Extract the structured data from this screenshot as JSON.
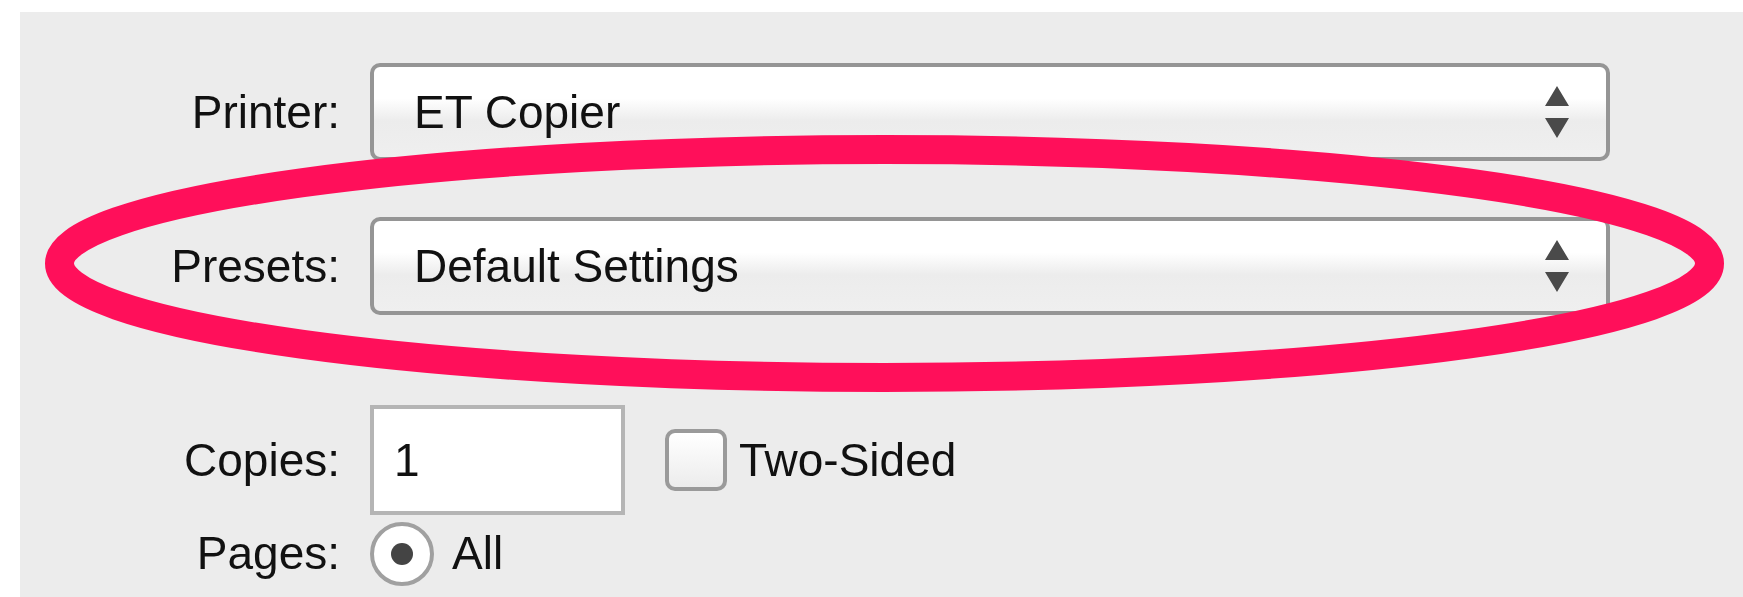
{
  "printer": {
    "label": "Printer:",
    "value": "ET Copier"
  },
  "presets": {
    "label": "Presets:",
    "value": "Default Settings"
  },
  "copies": {
    "label": "Copies:",
    "value": "1"
  },
  "two_sided": {
    "label": "Two-Sided",
    "checked": false
  },
  "pages": {
    "label": "Pages:",
    "options": [
      {
        "label": "All",
        "selected": true
      }
    ]
  }
}
